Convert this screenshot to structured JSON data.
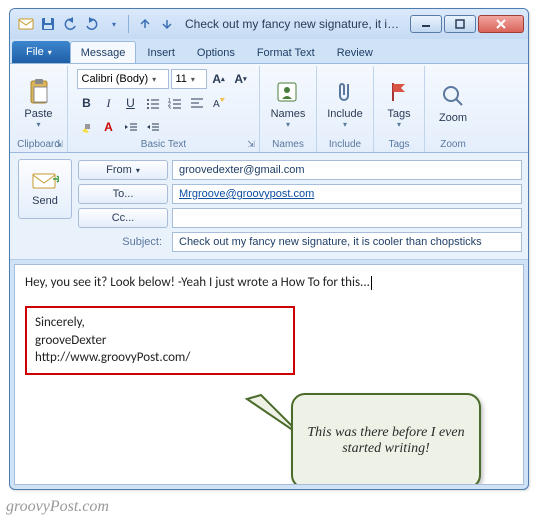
{
  "window": {
    "title": "Check out my fancy new signature, it is co..."
  },
  "tabs": {
    "file": "File",
    "items": [
      "Message",
      "Insert",
      "Options",
      "Format Text",
      "Review"
    ],
    "active": "Message"
  },
  "ribbon": {
    "clipboard": {
      "paste": "Paste",
      "label": "Clipboard"
    },
    "font": {
      "name": "Calibri (Body)",
      "size": "11",
      "label": "Basic Text"
    },
    "names": {
      "btn": "Names",
      "label": "Names"
    },
    "include": {
      "btn": "Include",
      "label": "Include"
    },
    "tags": {
      "btn": "Tags",
      "label": "Tags"
    },
    "zoom": {
      "btn": "Zoom",
      "label": "Zoom"
    }
  },
  "headers": {
    "send": "Send",
    "from_btn": "From",
    "from_value": "groovedexter@gmail.com",
    "to_btn": "To...",
    "to_value": "Mrgroove@groovypost.com",
    "cc_btn": "Cc...",
    "cc_value": "",
    "subject_label": "Subject:",
    "subject_value": "Check out my fancy new signature, it is cooler than chopsticks"
  },
  "body": {
    "line": "Hey, you see it?  Look below!  -Yeah I just wrote a How To for this...",
    "sig1": "Sincerely,",
    "sig2": "grooveDexter",
    "sig3": "http://www.groovyPost.com/"
  },
  "callout": "This was there before I even started writing!",
  "watermark": "groovyPost.com"
}
